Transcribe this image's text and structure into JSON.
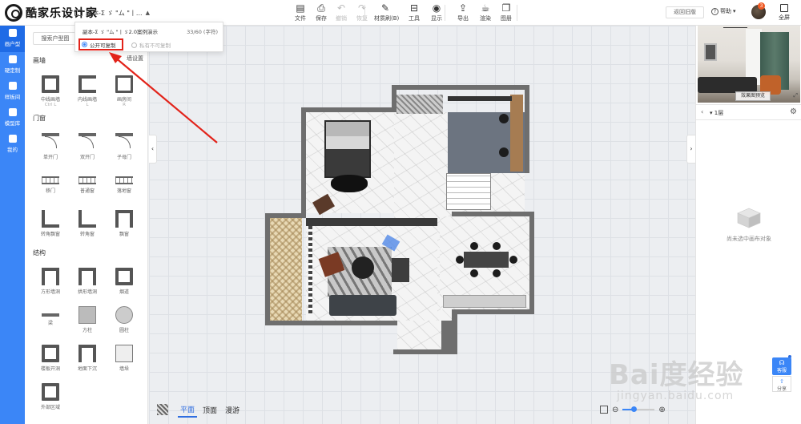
{
  "app": {
    "name": "酷家乐设计家"
  },
  "document": {
    "name": "副本-Σ ゞ \"ム \"丨..."
  },
  "toolbar": [
    {
      "key": "file",
      "label": "文件",
      "icon": "file-icon",
      "glyph": "▤",
      "enabled": true
    },
    {
      "key": "save",
      "label": "保存",
      "icon": "save-icon",
      "glyph": "⎙",
      "enabled": true
    },
    {
      "key": "undo",
      "label": "撤销",
      "icon": "undo-icon",
      "glyph": "↶",
      "enabled": false
    },
    {
      "key": "redo",
      "label": "恢复",
      "icon": "redo-icon",
      "glyph": "↷",
      "enabled": false
    },
    {
      "key": "material",
      "label": "材质刷(B)",
      "icon": "brush-icon",
      "glyph": "✎",
      "enabled": true
    },
    {
      "key": "tools",
      "label": "工具",
      "icon": "toolbox-icon",
      "glyph": "⊟",
      "enabled": true
    },
    {
      "key": "display",
      "label": "显示",
      "icon": "eye-icon",
      "glyph": "◉",
      "enabled": true
    },
    {
      "key": "export",
      "label": "导出",
      "icon": "export-icon",
      "glyph": "⇪",
      "enabled": true
    },
    {
      "key": "render",
      "label": "渲染",
      "icon": "teapot-icon",
      "glyph": "☕",
      "enabled": true
    },
    {
      "key": "gallery",
      "label": "图册",
      "icon": "gallery-icon",
      "glyph": "❐",
      "enabled": true
    }
  ],
  "header_right": {
    "old_version": "返回旧版",
    "help": "帮助",
    "avatar_badge": "3",
    "fullscreen": "全屏"
  },
  "leftnav": [
    {
      "label": "画户型",
      "icon": "floorplan-icon",
      "active": true
    },
    {
      "label": "硬定制",
      "icon": "tools-icon",
      "active": false
    },
    {
      "label": "样板间",
      "icon": "house-icon",
      "active": false
    },
    {
      "label": "模型库",
      "icon": "cube-icon",
      "active": false
    },
    {
      "label": "我的",
      "icon": "user-icon",
      "active": false
    }
  ],
  "leftpanel": {
    "search_label": "搜索户型图",
    "wall_setting": "墙设置",
    "sections": {
      "walls": "画墙",
      "doors": "门窗",
      "structure": "结构"
    },
    "wall_items": [
      {
        "label": "中线画墙",
        "sub": "Ctrl L"
      },
      {
        "label": "内线画墙",
        "sub": "L"
      },
      {
        "label": "画房间",
        "sub": "R"
      }
    ],
    "door_items": [
      {
        "label": "单开门"
      },
      {
        "label": "双开门"
      },
      {
        "label": "子母门"
      },
      {
        "label": "移门"
      },
      {
        "label": "普通窗"
      },
      {
        "label": "落地窗"
      },
      {
        "label": "转角飘窗"
      },
      {
        "label": "转角窗"
      },
      {
        "label": "飘窗"
      }
    ],
    "structure_items": [
      {
        "label": "方形墙洞"
      },
      {
        "label": "拱形墙洞"
      },
      {
        "label": "烟道"
      },
      {
        "label": "梁"
      },
      {
        "label": "方柱"
      },
      {
        "label": "圆柱"
      },
      {
        "label": "楼板开洞"
      },
      {
        "label": "地面下沉"
      },
      {
        "label": "墙垛"
      },
      {
        "label": "外部区域"
      }
    ]
  },
  "popover": {
    "name": "副本-Σ ゞ \"ム \"丨ゞ2.0案例演示",
    "count": "33/60 (字符)",
    "public_label": "公开可复制",
    "private_label": "私有不可复制",
    "selected": "public"
  },
  "rightpanel": {
    "preview_button": "效果图预览",
    "floor_label": "1层",
    "empty_text": "尚未选中画布对象"
  },
  "float": {
    "service": "客服",
    "share": "分享"
  },
  "viewbar": {
    "tabs": [
      {
        "label": "平面",
        "active": true
      },
      {
        "label": "顶面",
        "active": false
      },
      {
        "label": "漫游",
        "active": false
      }
    ]
  },
  "zoom": {
    "level": 0.35
  },
  "watermark": {
    "main": "Bai度经验",
    "sub": "jingyan.baidu.com"
  },
  "colors": {
    "accent": "#3b86f7",
    "highlight": "#e2231a"
  }
}
